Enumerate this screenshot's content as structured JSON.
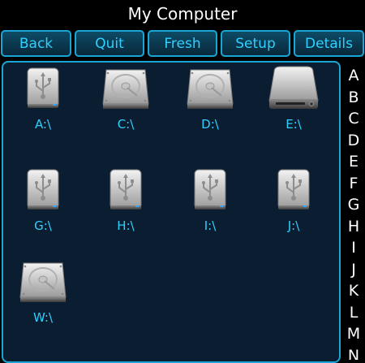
{
  "title": "My Computer",
  "toolbar": {
    "back": "Back",
    "quit": "Quit",
    "fresh": "Fresh",
    "setup": "Setup",
    "details": "Details"
  },
  "drives": [
    {
      "label": "A:\\",
      "icon": "usb-drive-icon"
    },
    {
      "label": "C:\\",
      "icon": "hard-disk-icon"
    },
    {
      "label": "D:\\",
      "icon": "hard-disk-icon"
    },
    {
      "label": "E:\\",
      "icon": "optical-drive-icon"
    },
    {
      "label": "G:\\",
      "icon": "usb-drive-icon"
    },
    {
      "label": "H:\\",
      "icon": "usb-drive-icon"
    },
    {
      "label": "I:\\",
      "icon": "usb-drive-icon"
    },
    {
      "label": "J:\\",
      "icon": "usb-drive-icon"
    },
    {
      "label": "W:\\",
      "icon": "hard-disk-icon"
    }
  ],
  "alphabet": [
    "A",
    "B",
    "C",
    "D",
    "E",
    "F",
    "G",
    "H",
    "I",
    "J",
    "K",
    "L",
    "M",
    "N"
  ],
  "colors": {
    "accent": "#2fd0ff",
    "border": "#1aa6d4",
    "panel": "#0b1d30",
    "background": "#000000"
  }
}
